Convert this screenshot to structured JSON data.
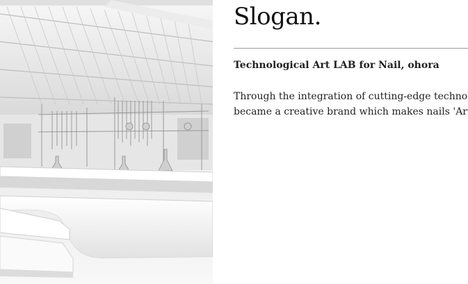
{
  "hero": {
    "image": "white laboratory interior with skylight roof and glass flasks on benches"
  },
  "section": {
    "title": "Slogan.",
    "subtitle": "Technological Art LAB for Nail, ohora",
    "description_lines": [
      "Through the integration of cutting-edge technologie",
      "became a creative brand which makes nails 'Art.'"
    ]
  }
}
